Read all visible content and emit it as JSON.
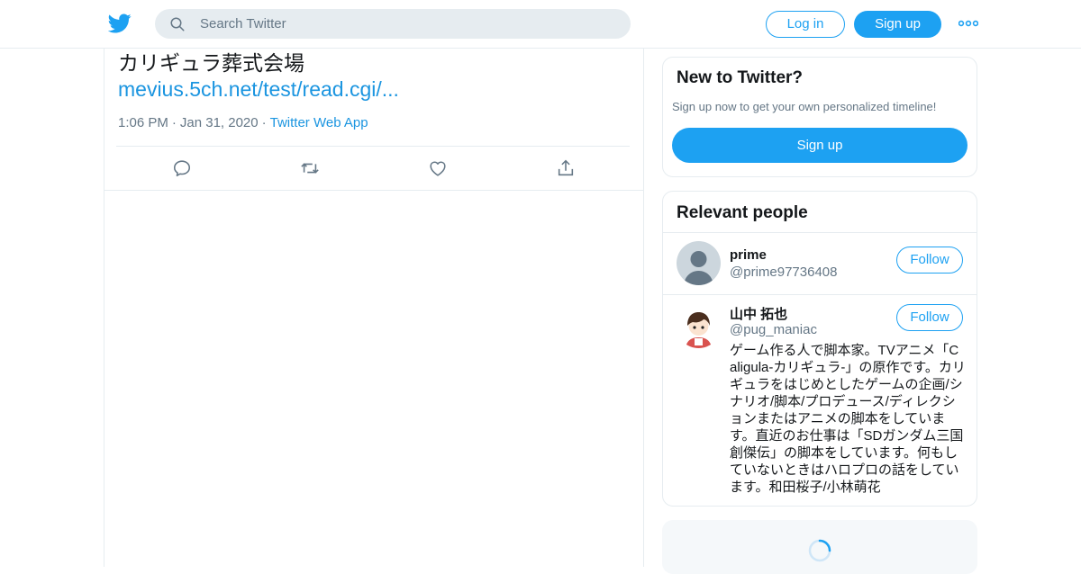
{
  "header": {
    "search_placeholder": "Search Twitter",
    "login_label": "Log in",
    "signup_label": "Sign up",
    "logo_icon": "twitter-bird-icon",
    "more_icon": "more-dots-icon",
    "accent": "#1da1f2"
  },
  "tweet": {
    "text": "カリギュラ葬式会場",
    "link": "mevius.5ch.net/test/read.cgi/...",
    "time": "1:06 PM",
    "date": "Jan 31, 2020",
    "source": "Twitter Web App",
    "actions": [
      "reply-icon",
      "retweet-icon",
      "like-icon",
      "share-icon"
    ]
  },
  "new_to_twitter": {
    "title": "New to Twitter?",
    "subtitle": "Sign up now to get your own personalized timeline!",
    "signup_label": "Sign up"
  },
  "relevant_people": {
    "title": "Relevant people",
    "people": [
      {
        "name": "prime",
        "handle": "@prime97736408",
        "follow_label": "Follow",
        "bio": ""
      },
      {
        "name": "山中 拓也",
        "handle": "@pug_maniac",
        "follow_label": "Follow",
        "bio": "ゲーム作る人で脚本家。TVアニメ「Caligula-カリギュラ-」の原作です。カリギュラをはじめとしたゲームの企画/シナリオ/脚本/プロデュース/ディレクションまたはアニメの脚本をしています。直近のお仕事は「SDガンダム三国創傑伝」の脚本をしています。何もしていないときはハロプロの話をしています。和田桜子/小林萌花"
      }
    ]
  }
}
